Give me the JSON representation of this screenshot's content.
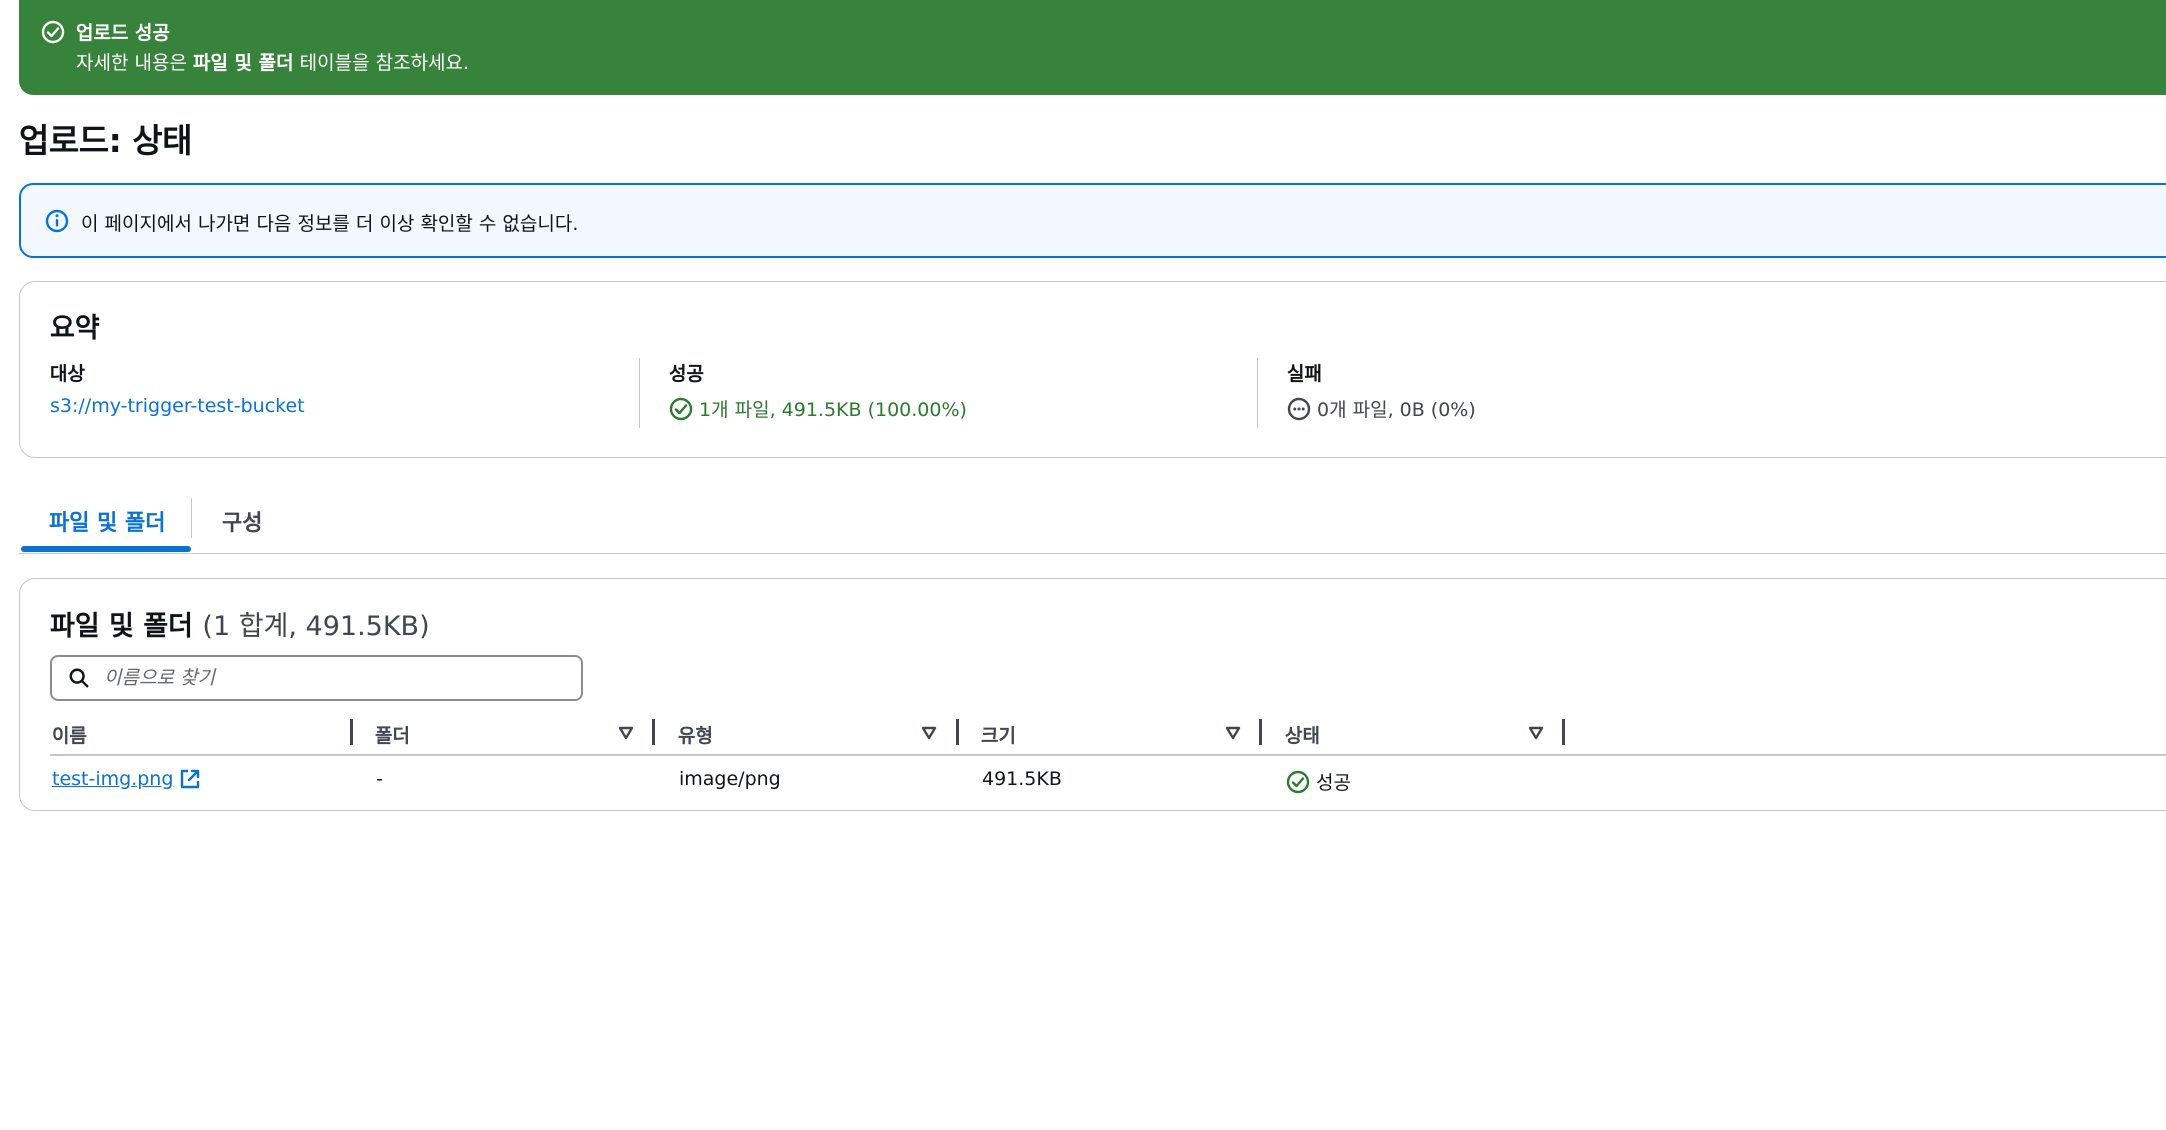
{
  "flash": {
    "title": "업로드 성공",
    "body_prefix": "자세한 내용은 ",
    "body_bold": "파일 및 폴더",
    "body_suffix": " 테이블을 참조하세요."
  },
  "page_title": "업로드: 상태",
  "info_alert": "이 페이지에서 나가면 다음 정보를 더 이상 확인할 수 없습니다.",
  "summary": {
    "title": "요약",
    "destination_label": "대상",
    "destination_value": "s3://my-trigger-test-bucket",
    "succeeded_label": "성공",
    "succeeded_value": "1개 파일, 491.5KB (100.00%)",
    "failed_label": "실패",
    "failed_value": "0개 파일, 0B (0%)"
  },
  "tabs": [
    {
      "label": "파일 및 폴더",
      "active": true
    },
    {
      "label": "구성",
      "active": false
    }
  ],
  "files": {
    "title": "파일 및 폴더",
    "count": "(1 합계, 491.5KB)",
    "search_placeholder": "이름으로 찾기",
    "columns": [
      "이름",
      "폴더",
      "유형",
      "크기",
      "상태"
    ],
    "rows": [
      {
        "name": "test-img.png",
        "folder": "-",
        "type": "image/png",
        "size": "491.5KB",
        "status": "성공"
      }
    ]
  },
  "colors": {
    "success_green": "#37833b",
    "link_blue": "#0972d3",
    "info_bg": "#f2f8fd"
  },
  "icons": [
    "status-positive-icon",
    "info-icon",
    "status-in-progress-icon",
    "search-icon",
    "sort-caret-icon",
    "external-link-icon"
  ]
}
